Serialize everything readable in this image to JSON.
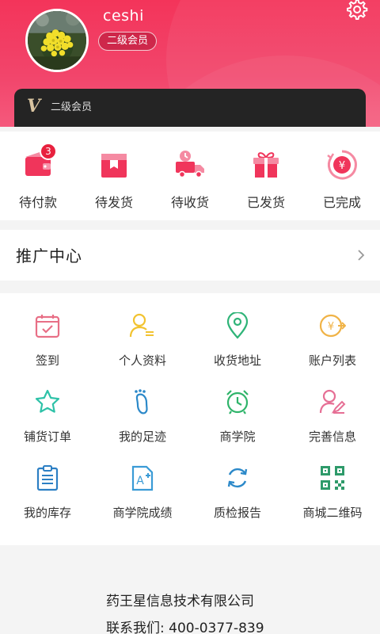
{
  "profile": {
    "username": "ceshi",
    "level_badge": "二级会员",
    "vip_mark": "V",
    "vip_label": "二级会员"
  },
  "orders": [
    {
      "label": "待付款",
      "icon": "wallet-icon",
      "badge": "3"
    },
    {
      "label": "待发货",
      "icon": "package-box-icon"
    },
    {
      "label": "待收货",
      "icon": "delivery-truck-icon"
    },
    {
      "label": "已发货",
      "icon": "gift-box-icon"
    },
    {
      "label": "已完成",
      "icon": "yuan-refund-icon"
    }
  ],
  "promo": {
    "title": "推广中心"
  },
  "services": [
    {
      "label": "签到",
      "icon": "calendar-check-icon"
    },
    {
      "label": "个人资料",
      "icon": "user-profile-icon"
    },
    {
      "label": "收货地址",
      "icon": "location-pin-icon"
    },
    {
      "label": "账户列表",
      "icon": "yuan-transfer-icon"
    },
    {
      "label": "铺货订单",
      "icon": "star-icon"
    },
    {
      "label": "我的足迹",
      "icon": "footprint-icon"
    },
    {
      "label": "商学院",
      "icon": "alarm-clock-icon"
    },
    {
      "label": "完善信息",
      "icon": "user-edit-icon"
    },
    {
      "label": "我的库存",
      "icon": "clipboard-list-icon"
    },
    {
      "label": "商学院成绩",
      "icon": "grade-document-icon"
    },
    {
      "label": "质检报告",
      "icon": "refresh-icon"
    },
    {
      "label": "商城二维码",
      "icon": "qr-code-icon"
    }
  ],
  "footer": {
    "company": "药王星信息技术有限公司",
    "contact": "联系我们:  400-0377-839"
  },
  "colors": {
    "brand": "#f2345a",
    "vip_bar": "#242424",
    "badge": "#e8213e"
  }
}
